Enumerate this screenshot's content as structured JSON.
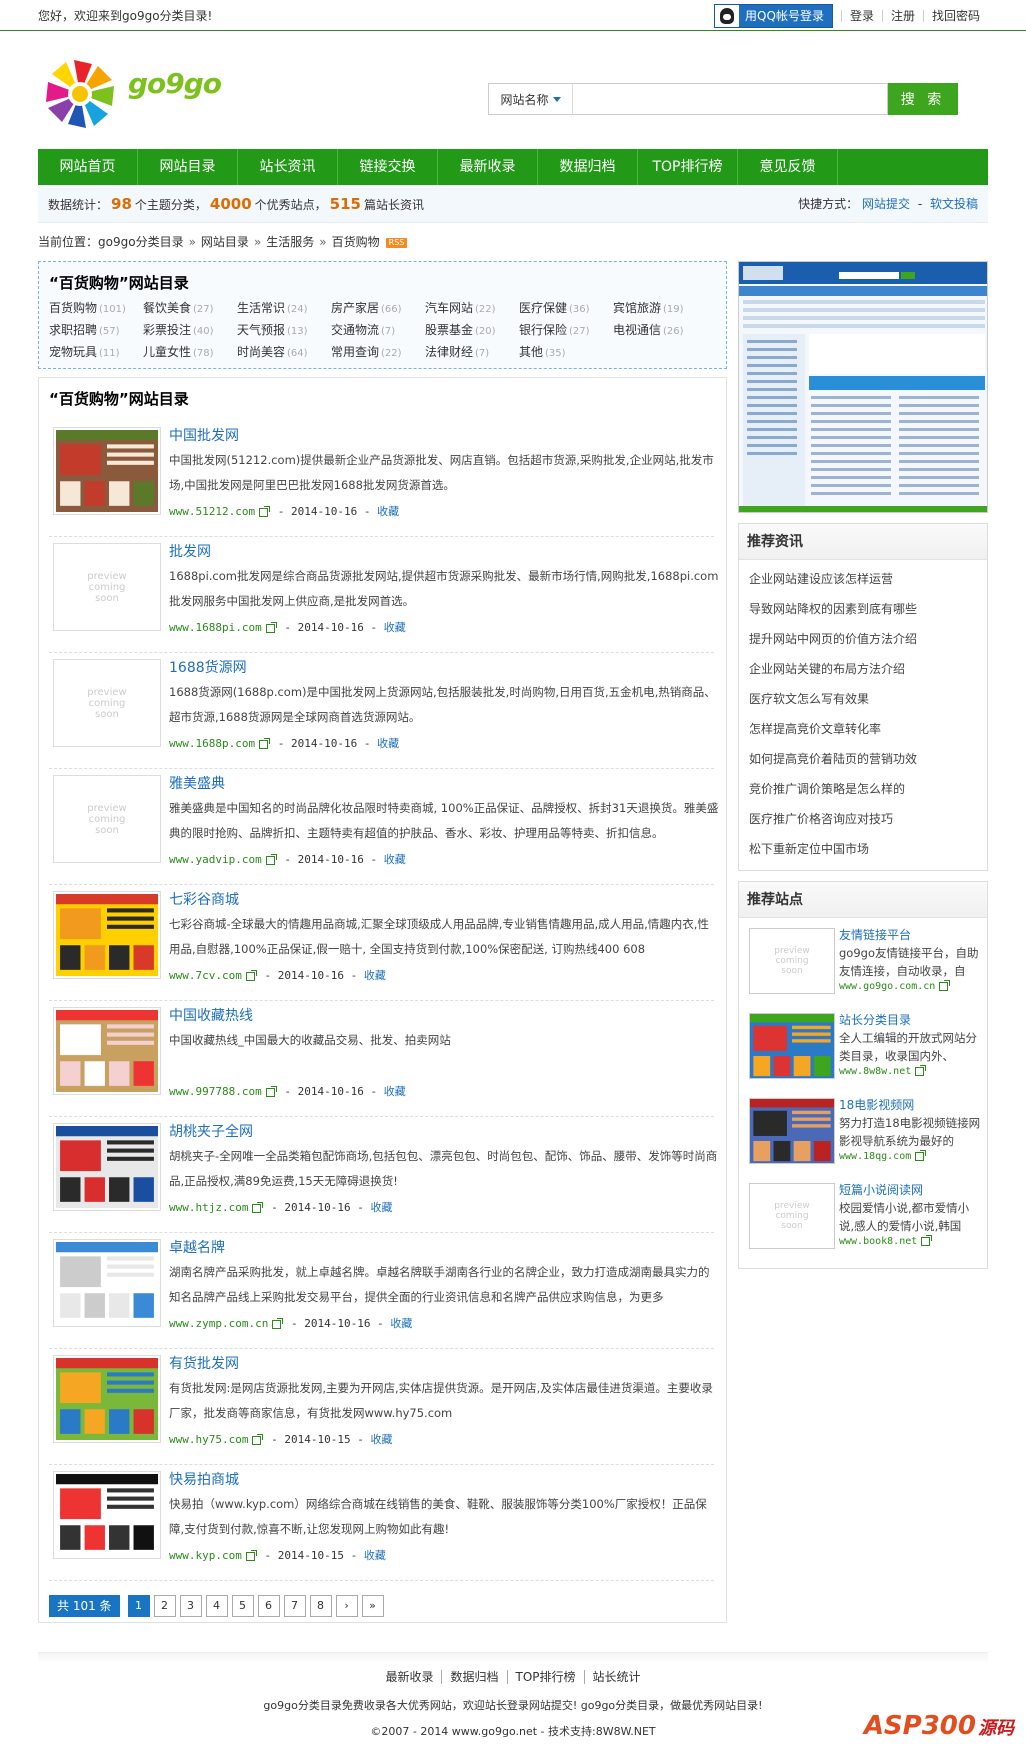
{
  "topbar": {
    "welcome": "您好，欢迎来到go9go分类目录!",
    "qq_login": "用QQ帐号登录",
    "links": [
      "登录",
      "注册",
      "找回密码"
    ]
  },
  "logo": {
    "text": "go9go"
  },
  "search": {
    "type_label": "网站名称",
    "value": "",
    "button": "搜 索"
  },
  "nav": [
    "网站首页",
    "网站目录",
    "站长资讯",
    "链接交换",
    "最新收录",
    "数据归档",
    "TOP排行榜",
    "意见反馈"
  ],
  "stats": {
    "prefix": "数据统计：",
    "categories": "98",
    "categories_unit": "个主题分类，",
    "sites": "4000",
    "sites_unit": "个优秀站点，",
    "articles": "515",
    "articles_unit": "篇站长资讯",
    "quick_label": "快捷方式：",
    "quick_submit": "网站提交",
    "quick_sep": "-",
    "quick_article": "软文投稿"
  },
  "breadcrumb": {
    "label": "当前位置：",
    "items": [
      "go9go分类目录",
      "网站目录",
      "生活服务",
      "百货购物"
    ],
    "sep": "»",
    "rss": "RSS"
  },
  "category_box": {
    "title": "“百货购物”网站目录",
    "items": [
      {
        "name": "百货购物",
        "count": "(101)"
      },
      {
        "name": "餐饮美食",
        "count": "(27)"
      },
      {
        "name": "生活常识",
        "count": "(24)"
      },
      {
        "name": "房产家居",
        "count": "(66)"
      },
      {
        "name": "汽车网站",
        "count": "(22)"
      },
      {
        "name": "医疗保健",
        "count": "(36)"
      },
      {
        "name": "宾馆旅游",
        "count": "(19)"
      },
      {
        "name": "求职招聘",
        "count": "(57)"
      },
      {
        "name": "彩票投注",
        "count": "(40)"
      },
      {
        "name": "天气预报",
        "count": "(13)"
      },
      {
        "name": "交通物流",
        "count": "(7)"
      },
      {
        "name": "股票基金",
        "count": "(20)"
      },
      {
        "name": "银行保险",
        "count": "(27)"
      },
      {
        "name": "电视通信",
        "count": "(26)"
      },
      {
        "name": "宠物玩具",
        "count": "(11)"
      },
      {
        "name": "儿童女性",
        "count": "(78)"
      },
      {
        "name": "时尚美容",
        "count": "(64)"
      },
      {
        "name": "常用查询",
        "count": "(22)"
      },
      {
        "name": "法律财经",
        "count": "(7)"
      },
      {
        "name": "其他",
        "count": "(35)"
      }
    ]
  },
  "list": {
    "title": "“百货购物”网站目录",
    "placeholder_text": "preview coming soon",
    "fav_label": "收藏",
    "items": [
      {
        "title": "中国批发网",
        "desc": "中国批发网(51212.com)提供最新企业产品货源批发、网店直销。包括超市货源,采购批发,企业网站,批发市场,中国批发网是阿里巴巴批发网1688批发网货源首选。",
        "url": "www.51212.com",
        "date": "2014-10-16",
        "thumb": "shot-a"
      },
      {
        "title": "批发网",
        "desc": "1688pi.com批发网是综合商品货源批发网站,提供超市货源采购批发、最新市场行情,网购批发,1688pi.com批发网服务中国批发网上供应商,是批发网首选。",
        "url": "www.1688pi.com",
        "date": "2014-10-16",
        "thumb": "placeholder"
      },
      {
        "title": "1688货源网",
        "desc": "1688货源网(1688p.com)是中国批发网上货源网站,包括服装批发,时尚购物,日用百货,五金机电,热销商品、超市货源,1688货源网是全球网商首选货源网站。",
        "url": "www.1688p.com",
        "date": "2014-10-16",
        "thumb": "placeholder"
      },
      {
        "title": "雅美盛典",
        "desc": "雅美盛典是中国知名的时尚品牌化妆品限时特卖商城, 100%正品保证、品牌授权、拆封31天退换货。雅美盛典的限时抢购、品牌折扣、主题特卖有超值的护肤品、香水、彩妆、护理用品等特卖、折扣信息。",
        "url": "www.yadvip.com",
        "date": "2014-10-16",
        "thumb": "placeholder"
      },
      {
        "title": "七彩谷商城",
        "desc": "七彩谷商城-全球最大的情趣用品商城,汇聚全球顶级成人用品品牌,专业销售情趣用品,成人用品,情趣内衣,性用品,自慰器,100%正品保证,假一赔十, 全国支持货到付款,100%保密配送, 订购热线400 608",
        "url": "www.7cv.com",
        "date": "2014-10-16",
        "thumb": "shot-b"
      },
      {
        "title": "中国收藏热线",
        "desc": "中国收藏热线_中国最大的收藏品交易、批发、拍卖网站",
        "url": "www.997788.com",
        "date": "2014-10-16",
        "thumb": "shot-c"
      },
      {
        "title": "胡桃夹子全网",
        "desc": "胡桃夹子-全网唯一全品类箱包配饰商场,包括包包、漂亮包包、时尚包包、配饰、饰品、腰带、发饰等时尚商品,正品授权,满89免运费,15天无障碍退换货!",
        "url": "www.htjz.com",
        "date": "2014-10-16",
        "thumb": "shot-d"
      },
      {
        "title": "卓越名牌",
        "desc": "湖南名牌产品采购批发，就上卓越名牌。卓越名牌联手湖南各行业的名牌企业，致力打造成湖南最具实力的知名品牌产品线上采购批发交易平台，提供全面的行业资讯信息和名牌产品供应求购信息，为更多",
        "url": "www.zymp.com.cn",
        "date": "2014-10-16",
        "thumb": "shot-e"
      },
      {
        "title": "有货批发网",
        "desc": "有货批发网:是网店货源批发网,主要为开网店,实体店提供货源。是开网店,及实体店最佳进货渠道。主要收录厂家，批发商等商家信息，有货批发网www.hy75.com",
        "url": "www.hy75.com",
        "date": "2014-10-15",
        "thumb": "shot-f"
      },
      {
        "title": "快易拍商城",
        "desc": "快易拍（www.kyp.com）网络综合商城在线销售的美食、鞋靴、服装服饰等分类100%厂家授权！正品保障,支付货到付款,惊喜不断,让您发现网上购物如此有趣!",
        "url": "www.kyp.com",
        "date": "2014-10-15",
        "thumb": "shot-g"
      }
    ]
  },
  "pager": {
    "total": "共 101 条",
    "pages": [
      "1",
      "2",
      "3",
      "4",
      "5",
      "6",
      "7",
      "8",
      "›",
      "»"
    ],
    "current": "1"
  },
  "recommend_news": {
    "title": "推荐资讯",
    "items": [
      "企业网站建设应该怎样运营",
      "导致网站降权的因素到底有哪些",
      "提升网站中网页的价值方法介绍",
      "企业网站关键的布局方法介绍",
      "医疗软文怎么写有效果",
      "怎样提高竞价文章转化率",
      "如何提高竞价着陆页的营销功效",
      "竞价推广调价策略是怎么样的",
      "医疗推广价格咨询应对技巧",
      "松下重新定位中国市场"
    ]
  },
  "recommend_sites": {
    "title": "推荐站点",
    "items": [
      {
        "name": "友情链接平台",
        "desc": "go9go友情链接平台，自助友情连接，自动收录，自",
        "url": "www.go9go.com.cn",
        "thumb": "placeholder"
      },
      {
        "name": "站长分类目录",
        "desc": "全人工编辑的开放式网站分类目录，收录国内外、",
        "url": "www.8w8w.net",
        "thumb": "shot-h"
      },
      {
        "name": "18电影视频网",
        "desc": "努力打造18电影视频链接网影视导航系统为最好的",
        "url": "www.18qg.com",
        "thumb": "shot-i"
      },
      {
        "name": "短篇小说阅读网",
        "desc": "校园爱情小说,都市爱情小说,感人的爱情小说,韩国",
        "url": "www.book8.net",
        "thumb": "placeholder"
      }
    ]
  },
  "footer": {
    "links": [
      "最新收录",
      "数据归档",
      "TOP排行榜",
      "站长统计"
    ],
    "line": "go9go分类目录免费收录各大优秀网站，欢迎站长登录网站提交! go9go分类目录，做最优秀网站目录!",
    "copy": "©2007 - 2014 www.go9go.net - 技术支持:8W8W.NET",
    "watermark": "ASP300",
    "watermark_cn": "源码"
  },
  "colors": {
    "brand_green": "#229a18",
    "link_blue": "#1e6fbf",
    "accent_orange": "#e06b00"
  }
}
